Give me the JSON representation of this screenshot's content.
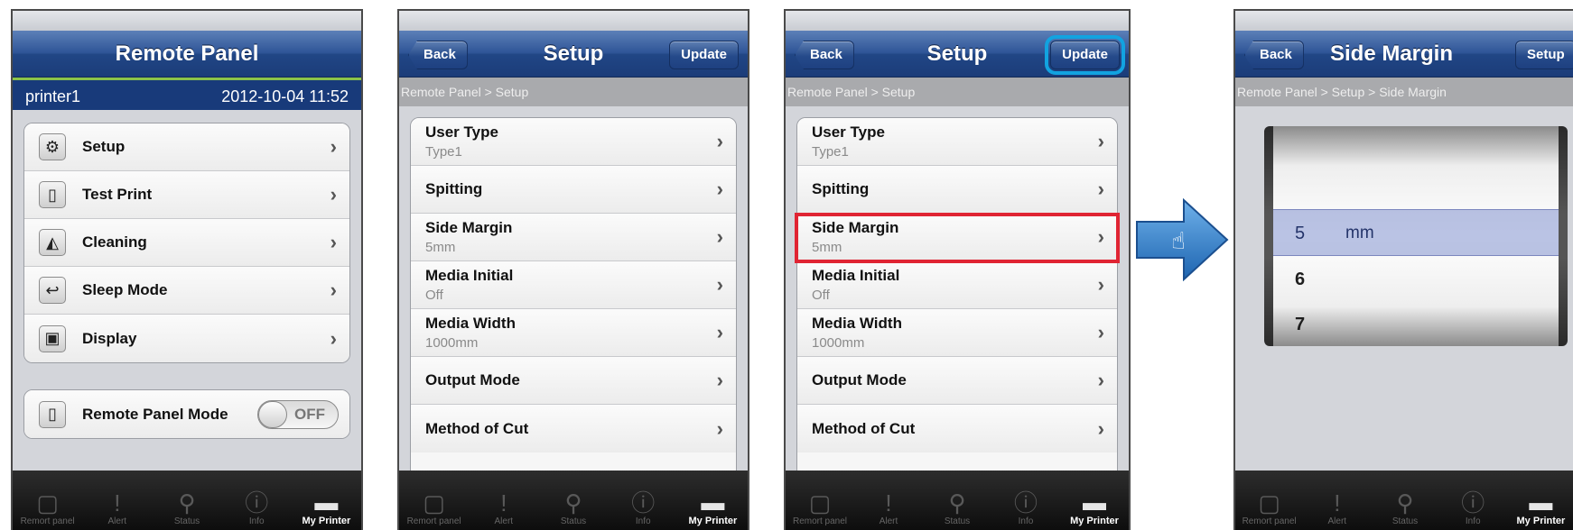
{
  "screen1": {
    "title": "Remote Panel",
    "printer_name": "printer1",
    "datetime": "2012-10-04 11:52",
    "menu": [
      {
        "label": "Setup",
        "icon": "gear-icon",
        "glyph": "⚙"
      },
      {
        "label": "Test Print",
        "icon": "page-icon",
        "glyph": "▯"
      },
      {
        "label": "Cleaning",
        "icon": "cleaning-icon",
        "glyph": "◭"
      },
      {
        "label": "Sleep Mode",
        "icon": "sleep-icon",
        "glyph": "↩"
      },
      {
        "label": "Display",
        "icon": "display-icon",
        "glyph": "▣"
      }
    ],
    "remote_panel_mode": {
      "label": "Remote Panel Mode",
      "state": "OFF"
    }
  },
  "screen2": {
    "back": "Back",
    "title": "Setup",
    "update": "Update",
    "breadcrumb": "Remote Panel > Setup",
    "items": [
      {
        "label": "User Type",
        "value": "Type1"
      },
      {
        "label": "Spitting",
        "value": ""
      },
      {
        "label": "Side Margin",
        "value": "5mm"
      },
      {
        "label": "Media Initial",
        "value": "Off"
      },
      {
        "label": "Media Width",
        "value": "1000mm"
      },
      {
        "label": "Output Mode",
        "value": ""
      },
      {
        "label": "Method of Cut",
        "value": ""
      }
    ]
  },
  "screen4": {
    "back": "Back",
    "title": "Side Margin",
    "setup": "Setup",
    "breadcrumb": "Remote Panel > Setup > Side Margin",
    "picker_values": [
      "5",
      "6",
      "7"
    ],
    "picker_unit": "mm",
    "selected_value": "5"
  },
  "tabbar": [
    {
      "label": "Remort panel",
      "icon": "remote-panel-icon",
      "glyph": "▢"
    },
    {
      "label": "Alert",
      "icon": "alert-icon",
      "glyph": "!"
    },
    {
      "label": "Status",
      "icon": "search-icon",
      "glyph": "⚲"
    },
    {
      "label": "Info",
      "icon": "info-icon",
      "glyph": "ⓘ"
    },
    {
      "label": "My Printer",
      "icon": "printer-icon",
      "glyph": "▬"
    }
  ],
  "colors": {
    "nav_blue": "#214685",
    "highlight_red": "#e02433",
    "highlight_cyan": "#12a3e0",
    "arrow_blue": "#2a7cc7"
  }
}
